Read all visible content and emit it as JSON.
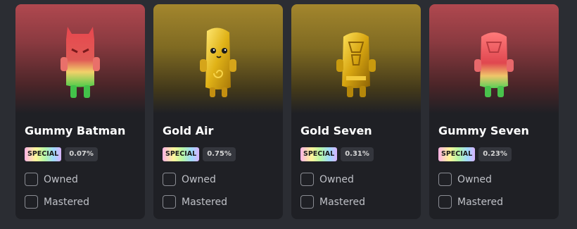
{
  "cards": [
    {
      "name": "Gummy Batman",
      "badge": "SPECIAL",
      "rarity": "0.07%",
      "owned_label": "Owned",
      "mastered_label": "Mastered",
      "art_icon": "gummy-batman-figure-icon",
      "bg": "red"
    },
    {
      "name": "Gold Air",
      "badge": "SPECIAL",
      "rarity": "0.75%",
      "owned_label": "Owned",
      "mastered_label": "Mastered",
      "art_icon": "gold-air-figure-icon",
      "bg": "gold"
    },
    {
      "name": "Gold Seven",
      "badge": "SPECIAL",
      "rarity": "0.31%",
      "owned_label": "Owned",
      "mastered_label": "Mastered",
      "art_icon": "gold-seven-figure-icon",
      "bg": "gold"
    },
    {
      "name": "Gummy Seven",
      "badge": "SPECIAL",
      "rarity": "0.23%",
      "owned_label": "Owned",
      "mastered_label": "Mastered",
      "art_icon": "gummy-seven-figure-icon",
      "bg": "red"
    }
  ],
  "colors": {
    "page_bg": "#2b2d33",
    "card_bg": "#1f2025",
    "red_glow": "#b0484f",
    "gold_glow": "#a3862d"
  }
}
